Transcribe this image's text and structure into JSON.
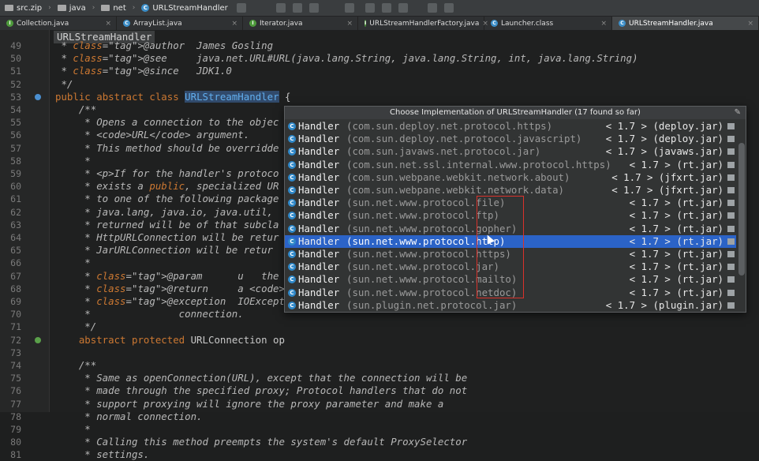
{
  "breadcrumbs": [
    "src.zip",
    "java",
    "net",
    "URLStreamHandler"
  ],
  "tabs": [
    {
      "label": "Collection.java",
      "active": false
    },
    {
      "label": "ArrayList.java",
      "active": false
    },
    {
      "label": "Iterator.java",
      "active": false
    },
    {
      "label": "URLStreamHandlerFactory.java",
      "active": false
    },
    {
      "label": "Launcher.class",
      "active": false
    },
    {
      "label": "URLStreamHandler.java",
      "active": true
    }
  ],
  "editor": {
    "class_chip": "URLStreamHandler",
    "lines": [
      {
        "num": "49",
        "text": " * @author  James Gosling"
      },
      {
        "num": "50",
        "text": " * @see     java.net.URL#URL(java.lang.String, java.lang.String, int, java.lang.String)"
      },
      {
        "num": "51",
        "text": " * @since   JDK1.0"
      },
      {
        "num": "52",
        "text": " */"
      },
      {
        "num": "53",
        "text": "public abstract class URLStreamHandler {"
      },
      {
        "num": "54",
        "text": "    /**"
      },
      {
        "num": "55",
        "text": "     * Opens a connection to the objec"
      },
      {
        "num": "56",
        "text": "     * <code>URL</code> argument."
      },
      {
        "num": "57",
        "text": "     * This method should be overridde"
      },
      {
        "num": "58",
        "text": "     *"
      },
      {
        "num": "59",
        "text": "     * <p>If for the handler's protoco"
      },
      {
        "num": "60",
        "text": "     * exists a public, specialized UR"
      },
      {
        "num": "61",
        "text": "     * to one of the following package"
      },
      {
        "num": "62",
        "text": "     * java.lang, java.io, java.util,"
      },
      {
        "num": "63",
        "text": "     * returned will be of that subcla"
      },
      {
        "num": "64",
        "text": "     * HttpURLConnection will be retur"
      },
      {
        "num": "65",
        "text": "     * JarURLConnection will be retur"
      },
      {
        "num": "66",
        "text": "     *"
      },
      {
        "num": "67",
        "text": "     * @param      u   the URL that th"
      },
      {
        "num": "68",
        "text": "     * @return     a <code>URLConnecti"
      },
      {
        "num": "69",
        "text": "     * @exception  IOException  if an"
      },
      {
        "num": "70",
        "text": "     *               connection."
      },
      {
        "num": "71",
        "text": "     */"
      },
      {
        "num": "72",
        "text": "    abstract protected URLConnection op"
      },
      {
        "num": "73",
        "text": ""
      },
      {
        "num": "74",
        "text": "    /**"
      },
      {
        "num": "75",
        "text": "     * Same as openConnection(URL), except that the connection will be"
      },
      {
        "num": "76",
        "text": "     * made through the specified proxy; Protocol handlers that do not"
      },
      {
        "num": "77",
        "text": "     * support proxying will ignore the proxy parameter and make a"
      },
      {
        "num": "78",
        "text": "     * normal connection."
      },
      {
        "num": "79",
        "text": "     *"
      },
      {
        "num": "80",
        "text": "     * Calling this method preempts the system's default ProxySelector"
      },
      {
        "num": "81",
        "text": "     * settings."
      }
    ]
  },
  "popup": {
    "title": "Choose Implementation of URLStreamHandler (17 found so far)",
    "items": [
      {
        "name": "Handler",
        "package": "(com.sun.deploy.net.protocol.https)",
        "location": "< 1.7 > (deploy.jar)"
      },
      {
        "name": "Handler",
        "package": "(com.sun.deploy.net.protocol.javascript)",
        "location": "< 1.7 > (deploy.jar)"
      },
      {
        "name": "Handler",
        "package": "(com.sun.javaws.net.protocol.jar)",
        "location": "< 1.7 > (javaws.jar)"
      },
      {
        "name": "Handler",
        "package": "(com.sun.net.ssl.internal.www.protocol.https)",
        "location": "< 1.7 > (rt.jar)"
      },
      {
        "name": "Handler",
        "package": "(com.sun.webpane.webkit.network.about)",
        "location": "< 1.7 > (jfxrt.jar)"
      },
      {
        "name": "Handler",
        "package": "(com.sun.webpane.webkit.network.data)",
        "location": "< 1.7 > (jfxrt.jar)"
      },
      {
        "name": "Handler",
        "package": "(sun.net.www.protocol.file)",
        "location": "< 1.7 > (rt.jar)"
      },
      {
        "name": "Handler",
        "package": "(sun.net.www.protocol.ftp)",
        "location": "< 1.7 > (rt.jar)"
      },
      {
        "name": "Handler",
        "package": "(sun.net.www.protocol.gopher)",
        "location": "< 1.7 > (rt.jar)"
      },
      {
        "name": "Handler",
        "package": "(sun.net.www.protocol.http)",
        "location": "< 1.7 > (rt.jar)",
        "selected": true
      },
      {
        "name": "Handler",
        "package": "(sun.net.www.protocol.https)",
        "location": "< 1.7 > (rt.jar)"
      },
      {
        "name": "Handler",
        "package": "(sun.net.www.protocol.jar)",
        "location": "< 1.7 > (rt.jar)"
      },
      {
        "name": "Handler",
        "package": "(sun.net.www.protocol.mailto)",
        "location": "< 1.7 > (rt.jar)"
      },
      {
        "name": "Handler",
        "package": "(sun.net.www.protocol.netdoc)",
        "location": "< 1.7 > (rt.jar)"
      },
      {
        "name": "Handler",
        "package": "(sun.plugin.net.protocol.jar)",
        "location": "< 1.7 > (plugin.jar)"
      }
    ]
  },
  "colors": {
    "selection": "#2b63c7",
    "highlight_box": "#d9322b",
    "keyword": "#cc7832",
    "javadoc_tag": "#d9a640"
  }
}
